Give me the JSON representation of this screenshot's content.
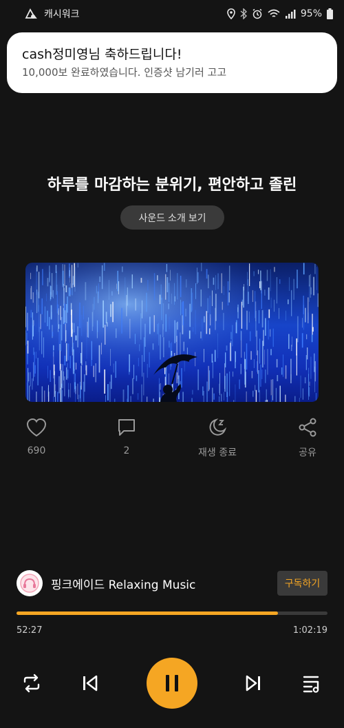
{
  "status_bar": {
    "app_name": "캐시워크",
    "battery": "95%",
    "icons": [
      "location-icon",
      "bluetooth-icon",
      "alarm-icon",
      "wifi-icon",
      "signal-icon",
      "battery-icon"
    ]
  },
  "notification": {
    "title": "cash정미영님 축하드립니다!",
    "body": "10,000보 완료하였습니다. 인증샷 남기러 고고"
  },
  "sound": {
    "title": "하루를 마감하는 분위기, 편안하고 졸린",
    "intro_button": "사운드 소개 보기"
  },
  "actions": {
    "like_count": "690",
    "comment_count": "2",
    "sleep_timer_label": "재생 종료",
    "share_label": "공유"
  },
  "channel": {
    "name": "핑크에이드 Relaxing Music",
    "subscribe_label": "구독하기"
  },
  "player": {
    "current_time": "52:27",
    "total_time": "1:02:19",
    "progress": 0.84,
    "state": "playing"
  },
  "colors": {
    "accent": "#f5a623",
    "background": "#141414",
    "button_bg": "#3a3a3a"
  }
}
